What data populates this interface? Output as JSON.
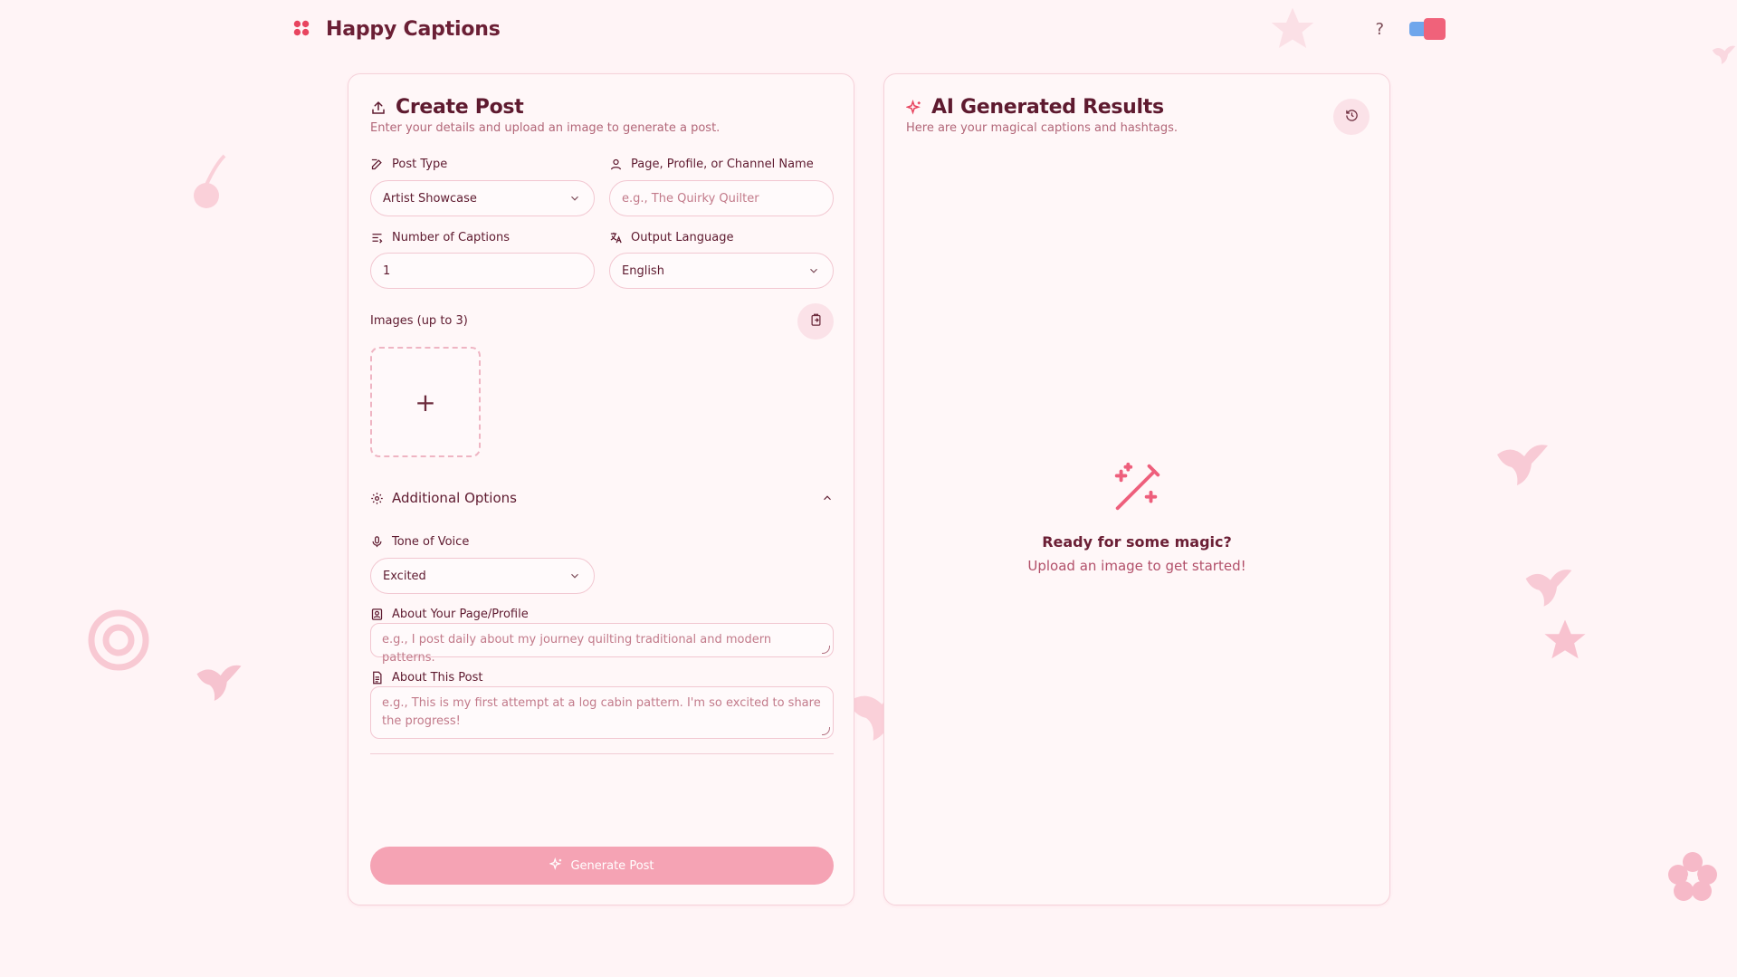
{
  "app": {
    "title": "Happy Captions"
  },
  "header": {
    "help_label": "?"
  },
  "create": {
    "title": "Create Post",
    "subtitle": "Enter your details and upload an image to generate a post.",
    "post_type": {
      "label": "Post Type",
      "value": "Artist Showcase"
    },
    "page_name": {
      "label": "Page, Profile, or Channel Name",
      "placeholder": "e.g., The Quirky Quilter"
    },
    "num_captions": {
      "label": "Number of Captions",
      "value": "1"
    },
    "language": {
      "label": "Output Language",
      "value": "English"
    },
    "images": {
      "label": "Images (up to 3)",
      "add_symbol": "+"
    },
    "additional_options": {
      "label": "Additional Options",
      "expanded": true
    },
    "tone": {
      "label": "Tone of Voice",
      "value": "Excited"
    },
    "about_page": {
      "label": "About Your Page/Profile",
      "placeholder": "e.g., I post daily about my journey quilting traditional and modern patterns."
    },
    "about_post": {
      "label": "About This Post",
      "placeholder": "e.g., This is my first attempt at a log cabin pattern. I'm so excited to share the progress!"
    },
    "generate_label": "Generate Post"
  },
  "results": {
    "title": "AI Generated Results",
    "subtitle": "Here are your magical captions and hashtags.",
    "empty_title": "Ready for some magic?",
    "empty_hint": "Upload an image to get started!"
  },
  "colors": {
    "accent": "#e8445f",
    "button": "#f5a3b4",
    "background": "#fff4f6",
    "text": "#5e1a2f"
  },
  "icons": {
    "logo": "flower-icon",
    "post_type": "edit-icon",
    "page_name": "user-icon",
    "num_captions": "list-icon",
    "language": "translate-icon",
    "paste": "clipboard-icon",
    "options": "gear-icon",
    "tone": "mic-icon",
    "about_page": "contact-icon",
    "about_post": "document-icon",
    "generate": "sparkles-icon",
    "results": "sparkles-icon",
    "history": "history-icon",
    "empty": "magic-wand-icon"
  }
}
